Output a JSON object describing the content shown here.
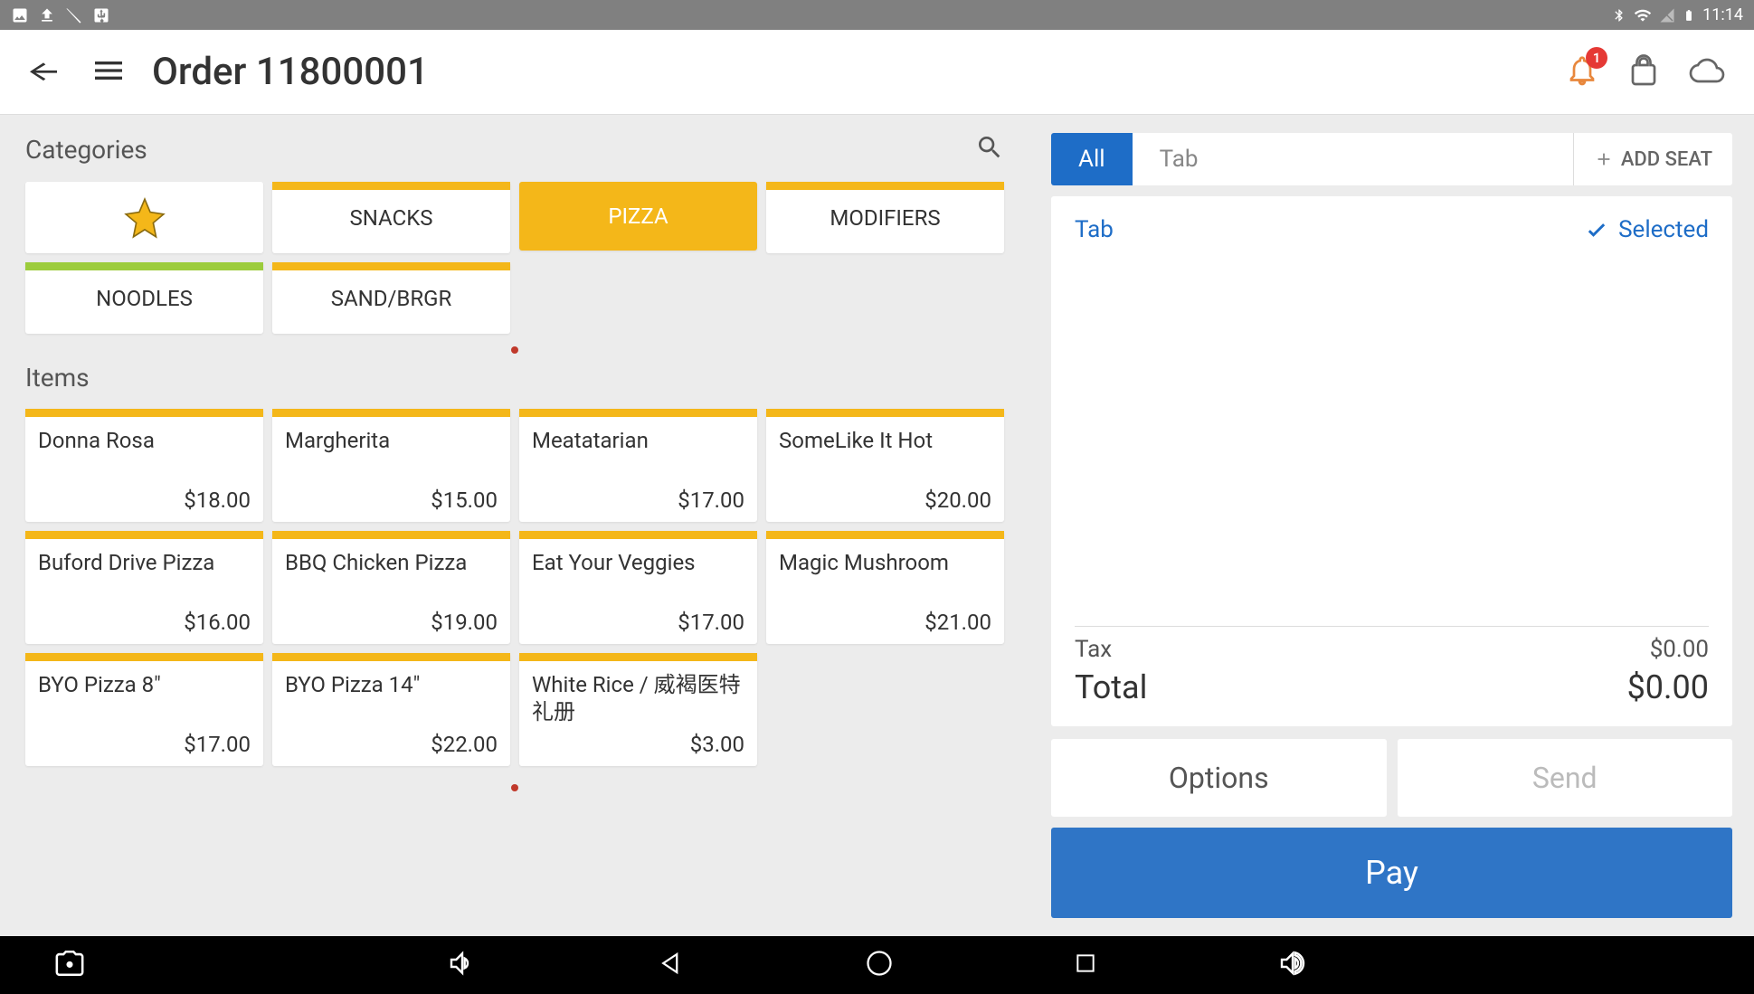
{
  "status": {
    "time": "11:14"
  },
  "header": {
    "title": "Order 11800001",
    "notif_count": "1"
  },
  "left": {
    "categories_label": "Categories",
    "items_label": "Items",
    "categories": [
      {
        "label": "",
        "stripe": "",
        "active": false,
        "star": true
      },
      {
        "label": "SNACKS",
        "stripe": "#f4b719",
        "active": false
      },
      {
        "label": "PIZZA",
        "stripe": "",
        "active": true
      },
      {
        "label": "MODIFIERS",
        "stripe": "#f4b719",
        "active": false
      },
      {
        "label": "NOODLES",
        "stripe": "#9ccc3c",
        "active": false
      },
      {
        "label": "SAND/BRGR",
        "stripe": "#f4b719",
        "active": false
      }
    ],
    "items": [
      {
        "name": "Donna Rosa",
        "price": "$18.00"
      },
      {
        "name": "Margherita",
        "price": "$15.00"
      },
      {
        "name": "Meatatarian",
        "price": "$17.00"
      },
      {
        "name": "SomeLike It Hot",
        "price": "$20.00"
      },
      {
        "name": "Buford Drive Pizza",
        "price": "$16.00"
      },
      {
        "name": "BBQ Chicken Pizza",
        "price": "$19.00"
      },
      {
        "name": "Eat Your Veggies",
        "price": "$17.00"
      },
      {
        "name": "Magic Mushroom",
        "price": "$21.00"
      },
      {
        "name": "BYO Pizza 8\"",
        "price": "$17.00"
      },
      {
        "name": "BYO Pizza 14\"",
        "price": "$22.00"
      },
      {
        "name": "White Rice / 威褐医特 礼册",
        "price": "$3.00"
      }
    ]
  },
  "right": {
    "all_tab": "All",
    "tab_tab": "Tab",
    "add_seat": "ADD SEAT",
    "ticket_tab": "Tab",
    "selected": "Selected",
    "tax_label": "Tax",
    "tax_value": "$0.00",
    "total_label": "Total",
    "total_value": "$0.00",
    "options_label": "Options",
    "send_label": "Send",
    "pay_label": "Pay"
  }
}
